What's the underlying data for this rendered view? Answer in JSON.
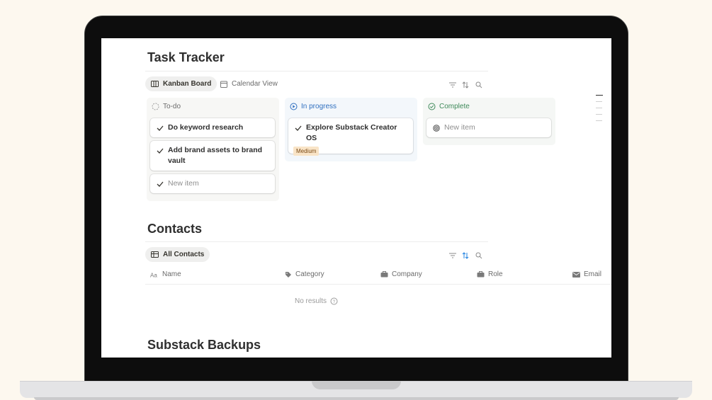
{
  "task_tracker": {
    "title": "Task Tracker",
    "views": [
      {
        "label": "Kanban Board",
        "icon": "kanban-icon",
        "active": true
      },
      {
        "label": "Calendar View",
        "icon": "calendar-icon",
        "active": false
      }
    ],
    "tools": [
      "filter-icon",
      "sort-icon",
      "search-icon"
    ],
    "columns": [
      {
        "label": "To-do",
        "icon": "dashed-circle-icon",
        "color": "#8a8a8a",
        "bg": "#f7f7f5",
        "cards": [
          {
            "title": "Do keyword research",
            "icon": "check-icon"
          },
          {
            "title": "Add brand assets to brand vault",
            "icon": "check-icon"
          },
          {
            "title": "New item",
            "icon": "check-icon",
            "placeholder": true
          }
        ]
      },
      {
        "label": "In progress",
        "icon": "play-circle-icon",
        "color": "#2f6fbf",
        "bg": "#f3f7fb",
        "cards": [
          {
            "title": "Explore Substack Creator OS",
            "icon": "check-icon",
            "tag": "Medium"
          }
        ]
      },
      {
        "label": "Complete",
        "icon": "check-circle-icon",
        "color": "#3f8a5a",
        "bg": "#f5f7f5",
        "cards": [
          {
            "title": "New item",
            "icon": "target-icon",
            "placeholder": true
          }
        ]
      }
    ]
  },
  "contacts": {
    "title": "Contacts",
    "view": {
      "label": "All Contacts",
      "icon": "table-icon"
    },
    "tools": [
      "filter-icon",
      "sort-icon",
      "search-icon"
    ],
    "sort_active_color": "#2383e2",
    "columns": [
      {
        "label": "Name",
        "icon": "text-icon"
      },
      {
        "label": "Category",
        "icon": "tag-icon"
      },
      {
        "label": "Company",
        "icon": "briefcase-icon"
      },
      {
        "label": "Role",
        "icon": "briefcase-icon"
      },
      {
        "label": "Email",
        "icon": "mail-icon"
      }
    ],
    "empty_text": "No results"
  },
  "backups": {
    "title": "Substack Backups"
  }
}
